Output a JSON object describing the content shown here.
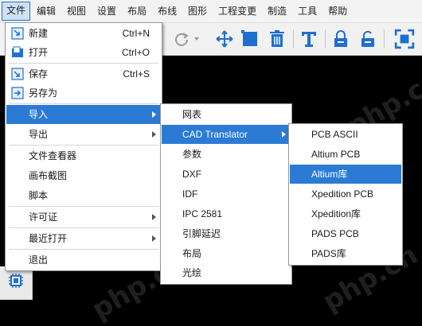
{
  "menubar": [
    "文件",
    "编辑",
    "视图",
    "设置",
    "布局",
    "布线",
    "图形",
    "工程变更",
    "制造",
    "工具",
    "帮助"
  ],
  "file_menu": {
    "items": [
      {
        "label": "新建",
        "shortcut": "Ctrl+N",
        "icon": "new-file-icon"
      },
      {
        "label": "打开",
        "shortcut": "Ctrl+O",
        "icon": "open-folder-icon"
      },
      {
        "label": "保存",
        "shortcut": "Ctrl+S",
        "icon": "save-icon"
      },
      {
        "label": "另存为",
        "shortcut": "",
        "icon": "save-as-icon"
      },
      {
        "label": "导入",
        "submenu": true
      },
      {
        "label": "导出",
        "submenu": true
      },
      {
        "label": "文件查看器"
      },
      {
        "label": "画布截图"
      },
      {
        "label": "脚本"
      },
      {
        "label": "许可证",
        "submenu": true
      },
      {
        "label": "最近打开",
        "submenu": true
      },
      {
        "label": "退出"
      }
    ]
  },
  "import_menu": {
    "items": [
      "网表",
      "CAD Translator",
      "参数",
      "DXF",
      "IDF",
      "IPC 2581",
      "引脚延迟",
      "布局",
      "光绘"
    ]
  },
  "cad_menu": {
    "items": [
      "PCB ASCII",
      "Altium PCB",
      "Altium库",
      "Xpedition PCB",
      "Xpedition库",
      "PADS PCB",
      "PADS库"
    ]
  },
  "watermark": "php.cn",
  "colors": {
    "highlight": "#2b7bd5",
    "toolbar_icon": "#1f6fd1",
    "canvas": "#000000"
  },
  "toolbar_icons": [
    "redo-icon",
    "move-icon",
    "square-select-icon",
    "delete-icon",
    "text-icon",
    "lock-icon",
    "unlock-icon",
    "fullscreen-icon"
  ]
}
